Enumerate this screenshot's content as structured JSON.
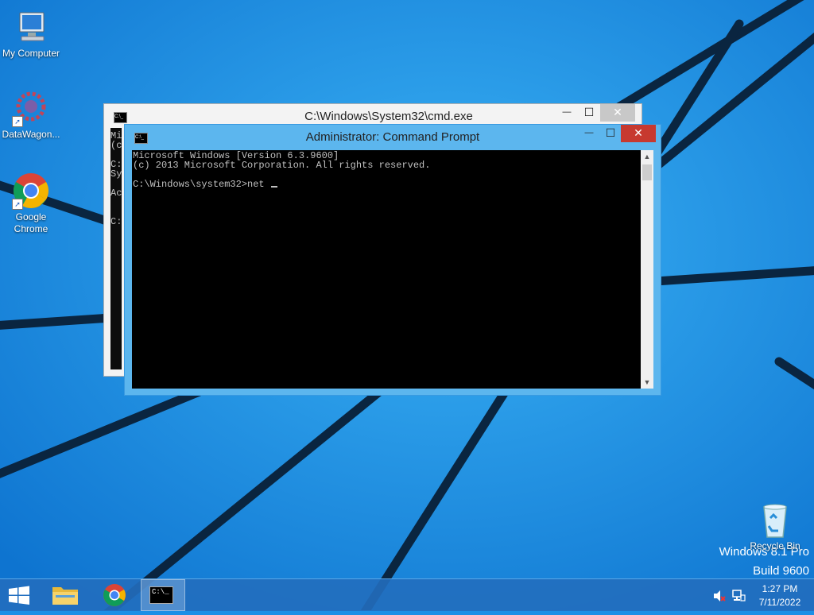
{
  "desktop": {
    "icons": [
      {
        "label": "My Computer",
        "icon": "computer-icon"
      },
      {
        "label": "DataWagon...",
        "icon": "datawagon-icon"
      },
      {
        "label": "Google Chrome",
        "icon": "chrome-icon"
      },
      {
        "label": "Recycle Bin",
        "icon": "recycle-bin-icon"
      }
    ],
    "watermark": {
      "line1": "Windows 8.1 Pro",
      "line2": "Build 9600"
    }
  },
  "back_window": {
    "title": "C:\\Windows\\System32\\cmd.exe",
    "visible_fragments": [
      "Mi",
      "(c",
      "C:",
      "Sy",
      "Ac",
      "C:"
    ]
  },
  "front_window": {
    "title": "Administrator: Command Prompt",
    "console_lines": [
      "Microsoft Windows [Version 6.3.9600]",
      "(c) 2013 Microsoft Corporation. All rights reserved.",
      "",
      "C:\\Windows\\system32>net "
    ]
  },
  "window_controls": {
    "minimize": "—",
    "maximize": "☐",
    "close": "✕"
  },
  "taskbar": {
    "start_icon": "windows-logo-icon",
    "pinned": [
      {
        "name": "file-explorer",
        "icon": "folder-icon"
      },
      {
        "name": "chrome",
        "icon": "chrome-icon"
      },
      {
        "name": "cmd",
        "icon": "cmd-icon",
        "active": true
      }
    ],
    "cmd_glyph": "C:\\_"
  },
  "tray": {
    "time": "1:27 PM",
    "date": "7/11/2022"
  },
  "colors": {
    "desktop": "#1b8fe6",
    "taskbar": "#226ebe",
    "close_button": "#c7392f"
  }
}
